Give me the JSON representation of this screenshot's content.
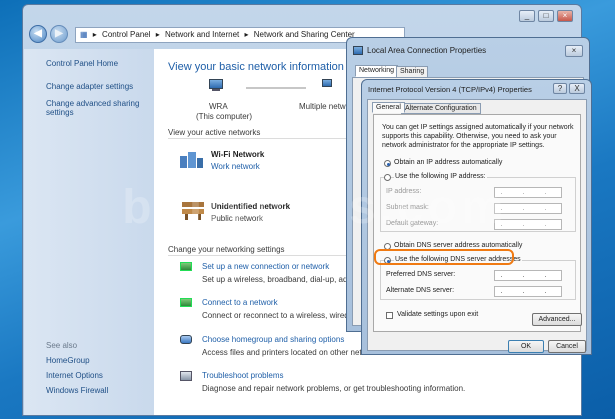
{
  "breadcrumb": [
    "Control Panel",
    "Network and Internet",
    "Network and Sharing Center"
  ],
  "control_panel": {
    "sidebar": {
      "home": "Control Panel Home",
      "items": [
        "Change adapter settings",
        "Change advanced sharing settings"
      ],
      "see_also_title": "See also",
      "see_also": [
        "HomeGroup",
        "Internet Options",
        "Windows Firewall"
      ]
    },
    "main": {
      "title": "View your basic network information and set up connections",
      "map": {
        "computer_name": "WRA",
        "computer_sub": "(This computer)",
        "multiple_networks": "Multiple networks"
      },
      "active_title": "View your active networks",
      "networks": [
        {
          "name": "Wi-Fi Network",
          "type": "Work network"
        },
        {
          "name": "Unidentified network",
          "type": "Public network"
        }
      ],
      "settings_title": "Change your networking settings",
      "tasks": [
        {
          "title": "Set up a new connection or network",
          "desc": "Set up a wireless, broadband, dial-up, ad hoc, or VPN connection; or set up a router or access point."
        },
        {
          "title": "Connect to a network",
          "desc": "Connect or reconnect to a wireless, wired, dial-up, or VPN network connection."
        },
        {
          "title": "Choose homegroup and sharing options",
          "desc": "Access files and printers located on other network computers, or change sharing settings."
        },
        {
          "title": "Troubleshoot problems",
          "desc": "Diagnose and repair network problems, or get troubleshooting information."
        }
      ]
    }
  },
  "lac_dialog": {
    "title": "Local Area Connection Properties",
    "tabs": [
      "Networking",
      "Sharing"
    ]
  },
  "ipv4_dialog": {
    "title": "Internet Protocol Version 4 (TCP/IPv4) Properties",
    "tabs": [
      "General",
      "Alternate Configuration"
    ],
    "intro": "You can get IP settings assigned automatically if your network supports this capability. Otherwise, you need to ask your network administrator for the appropriate IP settings.",
    "obtain_ip": "Obtain an IP address automatically",
    "use_ip": "Use the following IP address:",
    "ip_address": "IP address:",
    "subnet_mask": "Subnet mask:",
    "default_gateway": "Default gateway:",
    "obtain_dns": "Obtain DNS server address automatically",
    "use_dns": "Use the following DNS server addresses",
    "preferred_dns": "Preferred DNS server:",
    "alternate_dns": "Alternate DNS server:",
    "validate": "Validate settings upon exit",
    "advanced": "Advanced...",
    "ok": "OK",
    "cancel": "Cancel",
    "help": "?",
    "close": "X"
  },
  "ip_dots": ". . .",
  "watermark": "bullypass.com",
  "colors": {
    "accent": "#1f5fa8",
    "highlight": "#f07a12"
  }
}
